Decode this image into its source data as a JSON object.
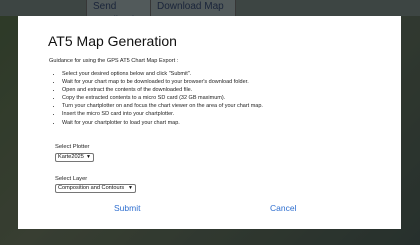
{
  "background": {
    "buttons": [
      "Send Feedback",
      "Download Map"
    ]
  },
  "modal": {
    "title": "AT5 Map Generation",
    "guidance": "Guidance for using the GPS AT5 Chart Map Export :",
    "steps": [
      "Select your desired options below and click \"Submit\".",
      "Wait for your chart map to be downloaded to your browser's download folder.",
      "Open and extract the contents of the downloaded file.",
      "Copy the extracted contents to a micro SD card (32 GB maximum).",
      "Turn your chartplotter on and focus the chart viewer on the area of your chart map.",
      "Insert the micro SD card into your chartplotter.",
      "Wait for your chartplotter to load your chart map."
    ],
    "plotter": {
      "label": "Select Plotter",
      "value": "Karte2025"
    },
    "layer": {
      "label": "Select Layer",
      "value": "Composition and Contours"
    },
    "submit_label": "Submit",
    "cancel_label": "Cancel"
  },
  "colors": {
    "link": "#2f6fd0",
    "modal_bg": "#ffffff"
  }
}
